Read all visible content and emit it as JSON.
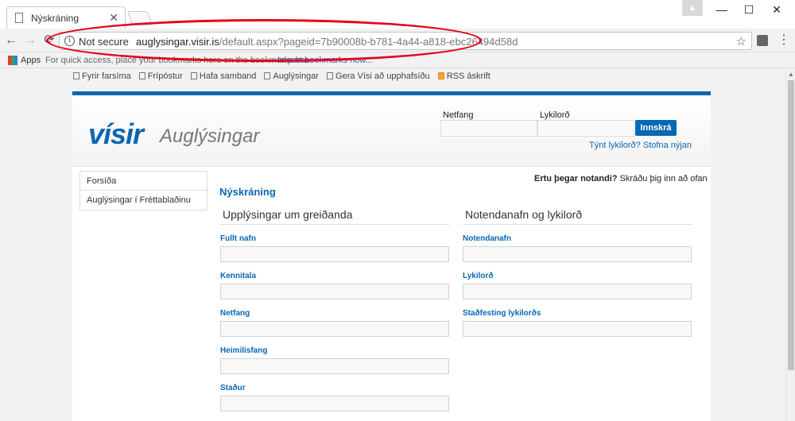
{
  "browser": {
    "tab_title": "Nýskráning",
    "tab_close": "✕",
    "window_user_icon": "user-icon",
    "window_min": "—",
    "window_max": "☐",
    "window_close": "✕",
    "back": "←",
    "forward": "→",
    "reload": "⟳",
    "info_glyph": "i",
    "security_label": "Not secure",
    "url_host": "auglysingar.visir.is",
    "url_path": "/default.aspx?pageid=7b90008b-b781-4a44-a818-ebc26494d58d",
    "star": "☆",
    "menu": "⋮",
    "apps_label": "Apps",
    "bookmarks_hint": "For quick access, place your bookmarks here on the bookmarks bar.",
    "bookmarks_import": "Import bookmarks now..."
  },
  "annotation": {
    "color": "#e5001a"
  },
  "top_links": [
    {
      "label": "Fyrir farsíma",
      "icon": "phone-icon"
    },
    {
      "label": "Frípóstur",
      "icon": "mail-icon"
    },
    {
      "label": "Hafa samband",
      "icon": "chat-icon"
    },
    {
      "label": "Auglýsingar",
      "icon": "ad-icon"
    },
    {
      "label": "Gera Vísi að upphafsíðu",
      "icon": "home-icon"
    },
    {
      "label": "RSS áskrift",
      "icon": "rss-icon"
    }
  ],
  "header": {
    "logo_main": "vísir",
    "logo_sub": "Auglýsingar",
    "email_label": "Netfang",
    "password_label": "Lykilorð",
    "login_button": "Innskrá",
    "forgot_link": "Týnt lykilorð?",
    "signup_link": "Stofna nýjan"
  },
  "sidebar": {
    "items": [
      {
        "label": "Forsíða"
      },
      {
        "label": "Auglýsingar í Fréttablaðinu"
      }
    ]
  },
  "main": {
    "already_bold": "Ertu þegar notandi?",
    "already_rest": " Skráðu þig inn að ofan",
    "heading": "Nýskráning",
    "left_section": {
      "title": "Upplýsingar um greiðanda",
      "fields": [
        "Fullt nafn",
        "Kennitala",
        "Netfang",
        "Heimilisfang",
        "Staður"
      ]
    },
    "right_section": {
      "title": "Notendanafn og lykilorð",
      "fields": [
        "Notendanafn",
        "Lykilorð",
        "Staðfesting lykilorðs"
      ]
    }
  },
  "colors": {
    "brand_blue": "#0a67b2",
    "annotation_red": "#e5001a"
  }
}
